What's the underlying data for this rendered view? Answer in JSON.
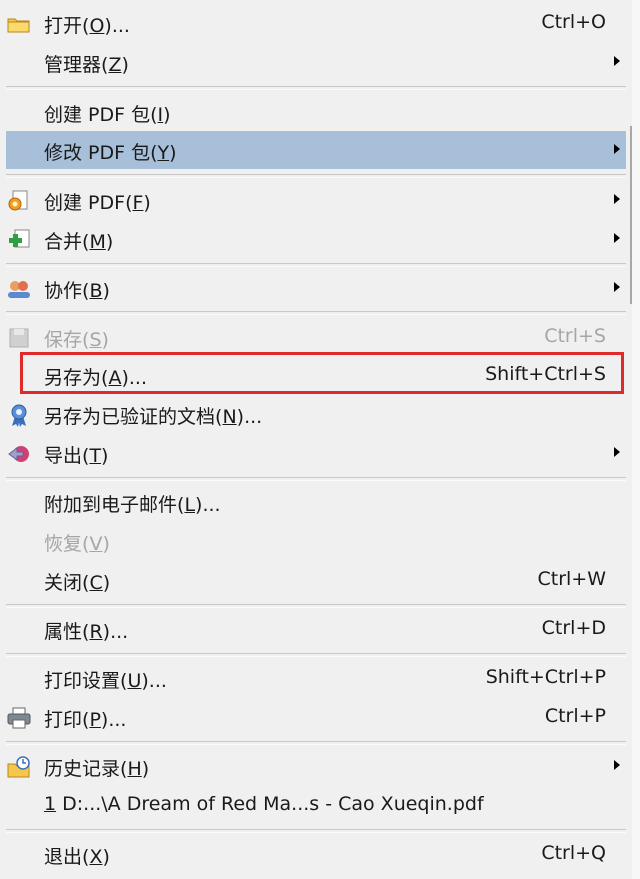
{
  "items": [
    {
      "name": "open",
      "label": "打开",
      "key": "O",
      "suffix": "...",
      "shortcut": "Ctrl+O",
      "icon": "folder-icon"
    },
    {
      "name": "organizer",
      "label": "管理器",
      "key": "Z",
      "suffix": "",
      "submenu": true
    },
    {
      "name": "create-pdf-package",
      "label": "创建 PDF 包",
      "key": "I",
      "suffix": ""
    },
    {
      "name": "modify-pdf-package",
      "label": "修改 PDF 包",
      "key": "Y",
      "suffix": "",
      "submenu": true,
      "highlighted": true
    },
    {
      "name": "create-pdf",
      "label": "创建 PDF",
      "key": "F",
      "suffix": "",
      "submenu": true,
      "icon": "create-pdf-icon"
    },
    {
      "name": "combine",
      "label": "合并",
      "key": "M",
      "suffix": "",
      "submenu": true,
      "icon": "combine-icon"
    },
    {
      "name": "collaborate",
      "label": "协作",
      "key": "B",
      "suffix": "",
      "submenu": true,
      "icon": "collaborate-icon"
    },
    {
      "name": "save",
      "label": "保存",
      "key": "S",
      "suffix": "",
      "shortcut": "Ctrl+S",
      "disabled": true,
      "icon": "save-icon"
    },
    {
      "name": "save-as",
      "label": "另存为",
      "key": "A",
      "suffix": "...",
      "shortcut": "Shift+Ctrl+S"
    },
    {
      "name": "save-as-certified",
      "label": "另存为已验证的文档",
      "key": "N",
      "suffix": "...",
      "icon": "certified-ribbon-icon"
    },
    {
      "name": "export",
      "label": "导出",
      "key": "T",
      "suffix": "",
      "submenu": true,
      "icon": "export-icon"
    },
    {
      "name": "attach-to-email",
      "label": "附加到电子邮件",
      "key": "L",
      "suffix": "..."
    },
    {
      "name": "revert",
      "label": "恢复",
      "key": "V",
      "suffix": "",
      "disabled": true
    },
    {
      "name": "close",
      "label": "关闭",
      "key": "C",
      "suffix": "",
      "shortcut": "Ctrl+W"
    },
    {
      "name": "properties",
      "label": "属性",
      "key": "R",
      "suffix": "...",
      "shortcut": "Ctrl+D"
    },
    {
      "name": "print-setup",
      "label": "打印设置",
      "key": "U",
      "suffix": "...",
      "shortcut": "Shift+Ctrl+P"
    },
    {
      "name": "print",
      "label": "打印",
      "key": "P",
      "suffix": "...",
      "shortcut": "Ctrl+P",
      "icon": "printer-icon"
    },
    {
      "name": "history",
      "label": "历史记录",
      "key": "H",
      "suffix": "",
      "submenu": true,
      "icon": "history-icon"
    },
    {
      "name": "recent-file-1",
      "label": "",
      "key": "1",
      "suffix": " D:...\\A Dream of Red Ma...s - Cao Xueqin.pdf"
    },
    {
      "name": "exit",
      "label": "退出",
      "key": "X",
      "suffix": "",
      "shortcut": "Ctrl+Q"
    }
  ],
  "colors": {
    "highlight": "#a7bfd8",
    "focus_box": "#e02a2a",
    "disabled": "#a6a6a6"
  }
}
